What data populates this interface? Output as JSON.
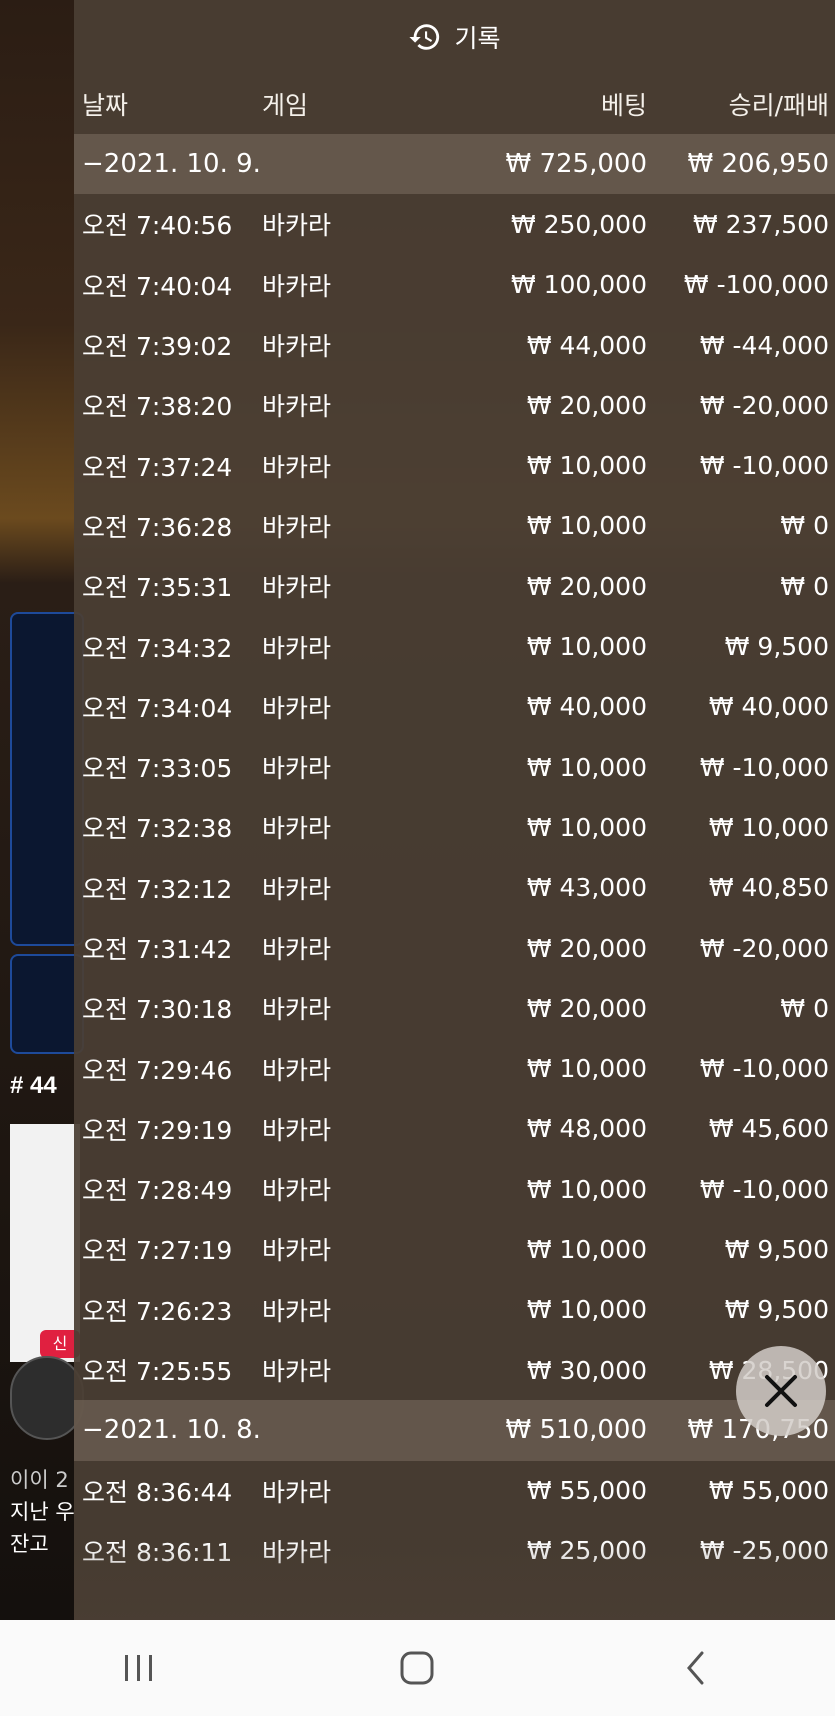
{
  "header": {
    "title": "기록",
    "icon": "history-icon"
  },
  "columns": {
    "date": "날짜",
    "game": "게임",
    "bet": "베팅",
    "win": "승리/패배"
  },
  "groups": [
    {
      "date": "−2021. 10. 9.",
      "bet_total": "₩ 725,000",
      "win_total": "₩ 206,950",
      "rows": [
        {
          "time": "오전 7:40:56",
          "game": "바카라",
          "bet": "₩ 250,000",
          "win": "₩ 237,500"
        },
        {
          "time": "오전 7:40:04",
          "game": "바카라",
          "bet": "₩ 100,000",
          "win": "₩ -100,000"
        },
        {
          "time": "오전 7:39:02",
          "game": "바카라",
          "bet": "₩ 44,000",
          "win": "₩ -44,000"
        },
        {
          "time": "오전 7:38:20",
          "game": "바카라",
          "bet": "₩ 20,000",
          "win": "₩ -20,000"
        },
        {
          "time": "오전 7:37:24",
          "game": "바카라",
          "bet": "₩ 10,000",
          "win": "₩ -10,000"
        },
        {
          "time": "오전 7:36:28",
          "game": "바카라",
          "bet": "₩ 10,000",
          "win": "₩ 0"
        },
        {
          "time": "오전 7:35:31",
          "game": "바카라",
          "bet": "₩ 20,000",
          "win": "₩ 0"
        },
        {
          "time": "오전 7:34:32",
          "game": "바카라",
          "bet": "₩ 10,000",
          "win": "₩ 9,500"
        },
        {
          "time": "오전 7:34:04",
          "game": "바카라",
          "bet": "₩ 40,000",
          "win": "₩ 40,000"
        },
        {
          "time": "오전 7:33:05",
          "game": "바카라",
          "bet": "₩ 10,000",
          "win": "₩ -10,000"
        },
        {
          "time": "오전 7:32:38",
          "game": "바카라",
          "bet": "₩ 10,000",
          "win": "₩ 10,000"
        },
        {
          "time": "오전 7:32:12",
          "game": "바카라",
          "bet": "₩ 43,000",
          "win": "₩ 40,850"
        },
        {
          "time": "오전 7:31:42",
          "game": "바카라",
          "bet": "₩ 20,000",
          "win": "₩ -20,000"
        },
        {
          "time": "오전 7:30:18",
          "game": "바카라",
          "bet": "₩ 20,000",
          "win": "₩ 0"
        },
        {
          "time": "오전 7:29:46",
          "game": "바카라",
          "bet": "₩ 10,000",
          "win": "₩ -10,000"
        },
        {
          "time": "오전 7:29:19",
          "game": "바카라",
          "bet": "₩ 48,000",
          "win": "₩ 45,600"
        },
        {
          "time": "오전 7:28:49",
          "game": "바카라",
          "bet": "₩ 10,000",
          "win": "₩ -10,000"
        },
        {
          "time": "오전 7:27:19",
          "game": "바카라",
          "bet": "₩ 10,000",
          "win": "₩ 9,500"
        },
        {
          "time": "오전 7:26:23",
          "game": "바카라",
          "bet": "₩ 10,000",
          "win": "₩ 9,500"
        },
        {
          "time": "오전 7:25:55",
          "game": "바카라",
          "bet": "₩ 30,000",
          "win": "₩ 28,500"
        }
      ]
    },
    {
      "date": "−2021. 10. 8.",
      "bet_total": "₩ 510,000",
      "win_total": "₩ 170,750",
      "rows": [
        {
          "time": "오전 8:36:44",
          "game": "바카라",
          "bet": "₩ 55,000",
          "win": "₩ 55,000"
        },
        {
          "time": "오전 8:36:11",
          "game": "바카라",
          "bet": "₩ 25,000",
          "win": "₩ -25,000"
        }
      ]
    }
  ],
  "background": {
    "round_label": "# 44",
    "new_badge": "신",
    "footer_line1": "이이 2",
    "footer_line2": "지난 우",
    "footer_line3": "잔고"
  },
  "close_button": {
    "icon": "close-icon"
  },
  "navbar": {
    "recent": "recent-apps-icon",
    "home": "home-icon",
    "back": "back-icon"
  }
}
